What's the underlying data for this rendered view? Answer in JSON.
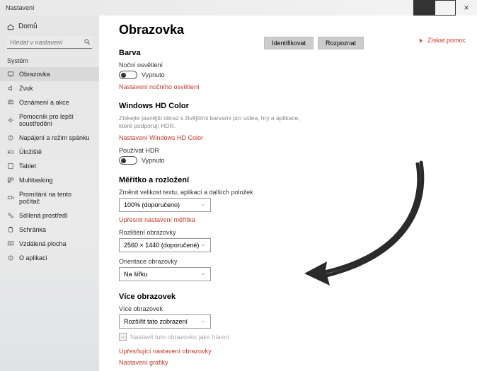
{
  "window": {
    "title": "Nastavení"
  },
  "sidebar": {
    "home": "Domů",
    "search_placeholder": "Hledat v nastavení",
    "section": "Systém",
    "items": [
      {
        "label": "Obrazovka"
      },
      {
        "label": "Zvuk"
      },
      {
        "label": "Oznámení a akce"
      },
      {
        "label": "Pomocník pro lepší soustředění"
      },
      {
        "label": "Napájení a režim spánku"
      },
      {
        "label": "Úložiště"
      },
      {
        "label": "Tablet"
      },
      {
        "label": "Multitasking"
      },
      {
        "label": "Promítání na tento počítač"
      },
      {
        "label": "Sdílená prostředí"
      },
      {
        "label": "Schránka"
      },
      {
        "label": "Vzdálená plocha"
      },
      {
        "label": "O aplikaci"
      }
    ]
  },
  "main": {
    "title": "Obrazovka",
    "buttons": {
      "identify": "Identifikovat",
      "detect": "Rozpoznat"
    },
    "help": "Získat pomoc",
    "color": {
      "heading": "Barva",
      "night_label": "Noční osvětlení",
      "night_state": "Vypnuto",
      "night_link": "Nastavení nočního osvětlení"
    },
    "hdcolor": {
      "heading": "Windows HD Color",
      "desc": "Získejte jasnější obraz s živějšími barvami pro videa, hry a aplikace, které podporují HDR.",
      "link": "Nastavení Windows HD Color",
      "hdr_label": "Používat HDR",
      "hdr_state": "Vypnuto"
    },
    "scale": {
      "heading": "Měřítko a rozložení",
      "size_label": "Změnit velikost textu, aplikací a dalších položek",
      "size_value": "100% (doporučeno)",
      "size_link": "Upřesnit nastavení měřítka",
      "res_label": "Rozlišení obrazovky",
      "res_value": "2560 × 1440 (doporučené)",
      "orient_label": "Orientace obrazovky",
      "orient_value": "Na šířku"
    },
    "multi": {
      "heading": "Více obrazovek",
      "mode_label": "Více obrazovek",
      "mode_value": "Rozšířit tato zobrazení",
      "primary_label": "Nastavit tuto obrazovku jako hlavní",
      "adv_link": "Upřesňující nastavení obrazovky",
      "gfx_link": "Nastavení grafiky"
    }
  }
}
